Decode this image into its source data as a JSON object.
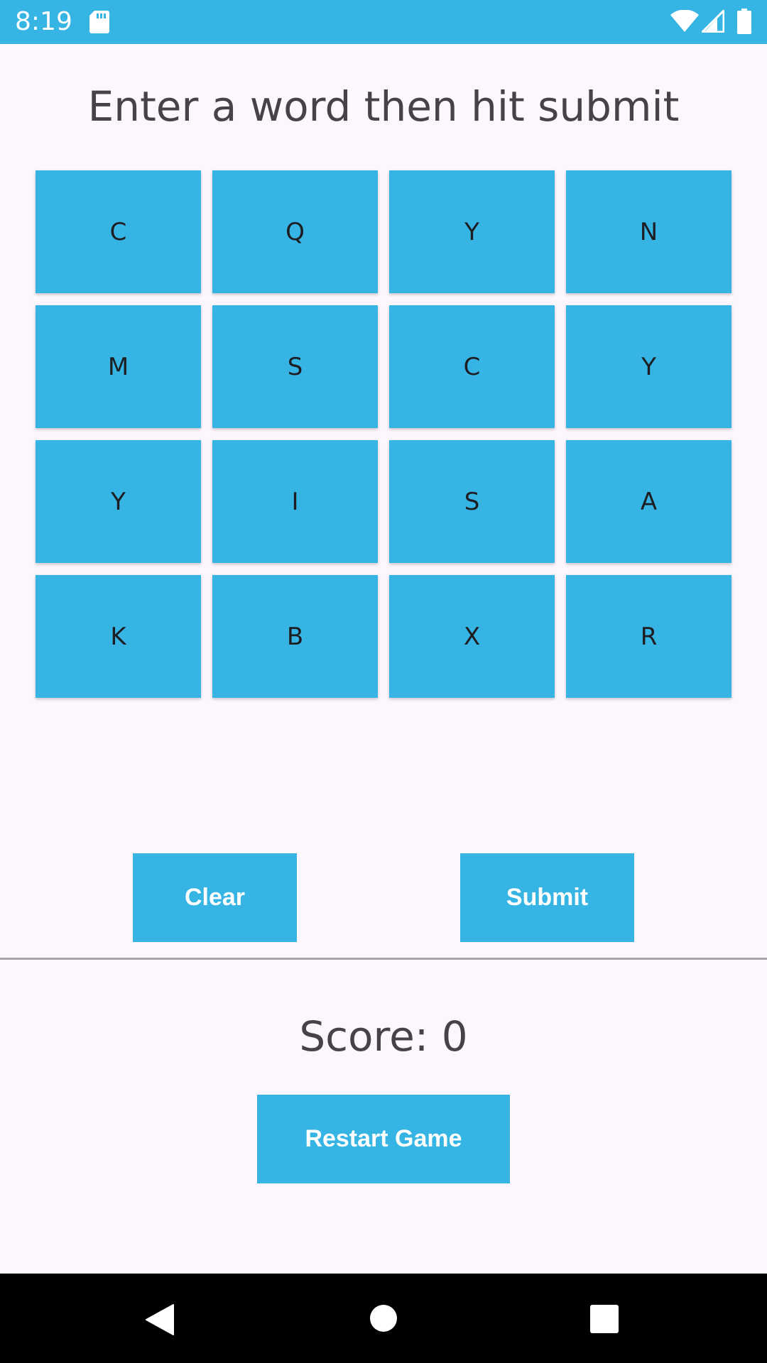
{
  "status_bar": {
    "time": "8:19",
    "icons": [
      "sd-card-icon",
      "wifi-icon",
      "signal-icon",
      "battery-icon"
    ],
    "color": "#36b5e5"
  },
  "instruction": "Enter a word then hit submit",
  "grid": {
    "rows": [
      [
        "C",
        "Q",
        "Y",
        "N"
      ],
      [
        "M",
        "S",
        "C",
        "Y"
      ],
      [
        "Y",
        "I",
        "S",
        "A"
      ],
      [
        "K",
        "B",
        "X",
        "R"
      ]
    ],
    "tile_color": "#36b5e5"
  },
  "actions": {
    "clear_label": "Clear",
    "submit_label": "Submit"
  },
  "score": {
    "text": "Score: 0"
  },
  "restart_label": "Restart Game",
  "nav_bar": {
    "icons": [
      "back-icon",
      "home-icon",
      "recents-icon"
    ]
  },
  "colors": {
    "accent": "#36b5e5",
    "background": "#fdf7fd",
    "text": "#47424a"
  }
}
